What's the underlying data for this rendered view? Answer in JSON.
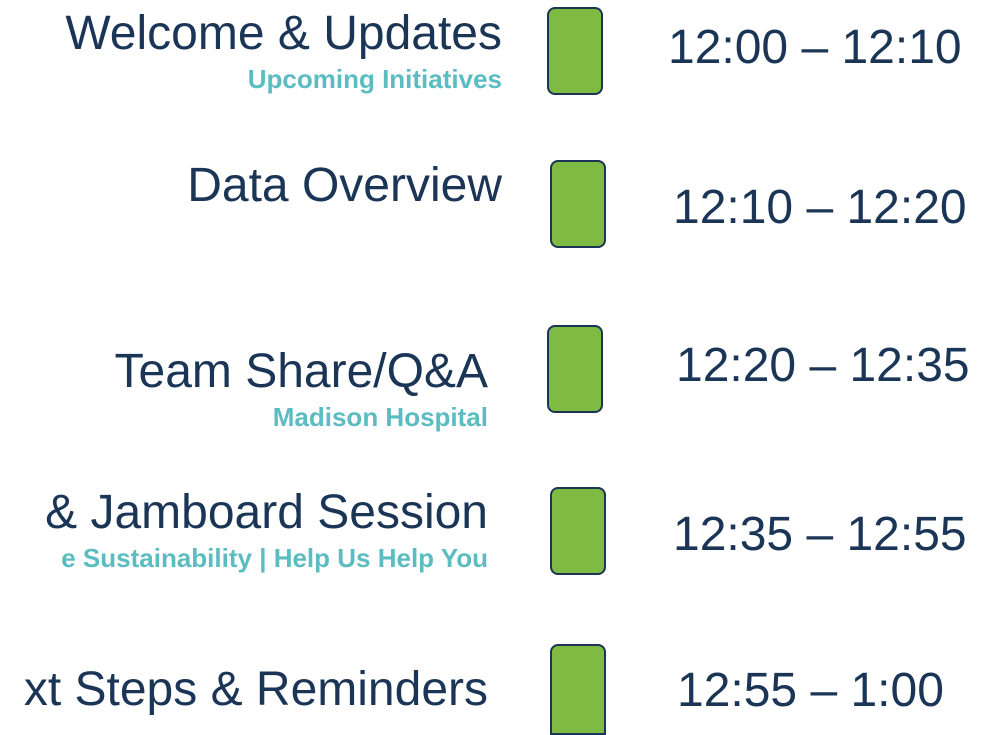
{
  "agenda": [
    {
      "title": "Welcome & Updates",
      "subtitle": "Upcoming Initiatives",
      "time": "12:00 – 12:10"
    },
    {
      "title": "Data Overview",
      "subtitle": "",
      "time": "12:10 – 12:20"
    },
    {
      "title": "Team Share/Q&A",
      "subtitle": "Madison Hospital",
      "time": "12:20 – 12:35"
    },
    {
      "title": "& Jamboard Session",
      "subtitle": "e Sustainability | Help Us Help You",
      "time": "12:35 – 12:55"
    },
    {
      "title": "xt Steps & Reminders",
      "subtitle": "",
      "time": "12:55 – 1:00"
    }
  ],
  "colors": {
    "title": "#1b3556",
    "subtitle": "#5bbcc1",
    "marker_fill": "#7fba42",
    "marker_border": "#1b3556"
  }
}
